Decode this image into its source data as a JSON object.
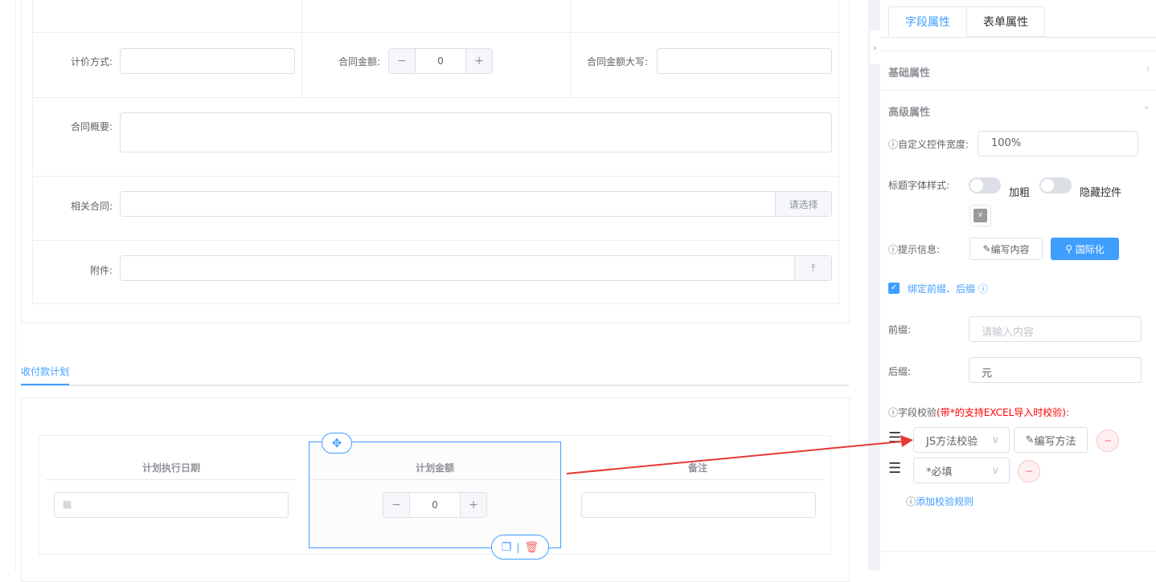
{
  "form": {
    "pricing_label": "计价方式:",
    "amount_label": "合同金额:",
    "amount_value": "0",
    "amount_upper_label": "合同金额大写:",
    "summary_label": "合同概要:",
    "related_label": "相关合同:",
    "related_button": "请选择",
    "attachment_label": "附件:"
  },
  "section_tab": "收付款计划",
  "subtable": {
    "columns": [
      "计划执行日期",
      "计划金额",
      "备注"
    ],
    "amount_value": "0"
  },
  "panel": {
    "tabs": [
      {
        "label": "字段属性",
        "active": true
      },
      {
        "label": "表单属性",
        "active": false
      }
    ],
    "basic": "基础属性",
    "advanced": "高级属性",
    "width_label": "自定义控件宽度:",
    "width_value": "100%",
    "font_style_label": "标题字体样式:",
    "bold_label": "加粗",
    "bold_on": false,
    "hide_label": "隐藏控件",
    "hide_on": false,
    "tip_label": "提示信息:",
    "edit_content": "编写内容",
    "i18n": "国际化",
    "bind_label": "绑定前缀、后缀",
    "bind_checked": true,
    "prefix_label": "前缀:",
    "prefix_placeholder": "请输入内容",
    "suffix_label": "后缀:",
    "suffix_value": "元",
    "validate_label": "字段校验",
    "validate_note": "(带*的支持EXCEL导入时校验)",
    "validate_colon": ":",
    "rules": [
      {
        "type": "JS方法校验",
        "edit": "编写方法"
      },
      {
        "type": "*必填"
      }
    ],
    "add_rule": "添加校验规则"
  },
  "colors": {
    "primary": "#409eff",
    "danger": "#f56c6c",
    "annotation_arrow": "#e53935"
  }
}
